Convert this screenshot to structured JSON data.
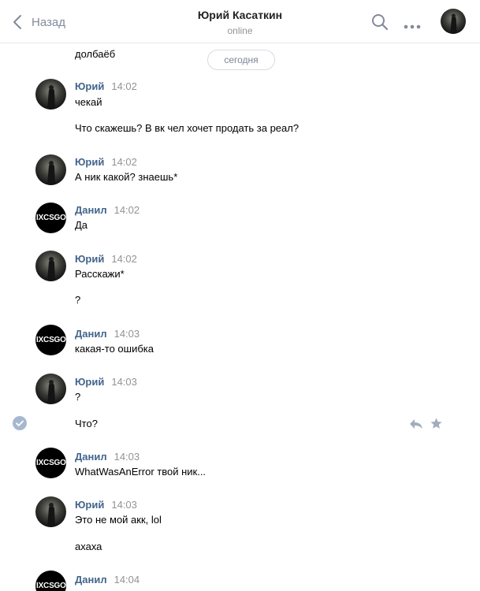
{
  "header": {
    "back_label": "Назад",
    "title": "Юрий Касаткин",
    "status": "online"
  },
  "feed": {
    "date_label": "сегодня",
    "partial_prev_message": "долбаёб",
    "avatar_text_danil": "IXCSGO",
    "messages": [
      {
        "sender": "Юрий",
        "time": "14:02",
        "texts": [
          "чекай",
          "Что скажешь? В вк чел хочет продать за реал?"
        ]
      },
      {
        "sender": "Юрий",
        "time": "14:02",
        "texts": [
          "А ник какой? знаешь*"
        ]
      },
      {
        "sender": "Данил",
        "time": "14:02",
        "texts": [
          "Да"
        ]
      },
      {
        "sender": "Юрий",
        "time": "14:02",
        "texts": [
          "Расскажи*",
          "?"
        ]
      },
      {
        "sender": "Данил",
        "time": "14:03",
        "texts": [
          "какая-то ошибка"
        ]
      },
      {
        "sender": "Юрий",
        "time": "14:03",
        "texts": [
          "?",
          "Что?"
        ]
      },
      {
        "sender": "Данил",
        "time": "14:03",
        "texts": [
          "WhatWasAnError твой ник..."
        ]
      },
      {
        "sender": "Юрий",
        "time": "14:03",
        "texts": [
          "Это не мой акк, lol",
          "ахаха"
        ]
      },
      {
        "sender": "Данил",
        "time": "14:04",
        "texts": []
      }
    ]
  },
  "icons": {
    "back": "chevron-left-icon",
    "search": "search-icon",
    "more": "more-dots-icon",
    "selected": "check-circle-icon",
    "reply": "reply-icon",
    "favorite": "star-icon"
  },
  "colors": {
    "sender_name": "#42648b",
    "time": "#939393",
    "icon_gray": "#828a99",
    "check_bg": "#a6b8cf"
  }
}
